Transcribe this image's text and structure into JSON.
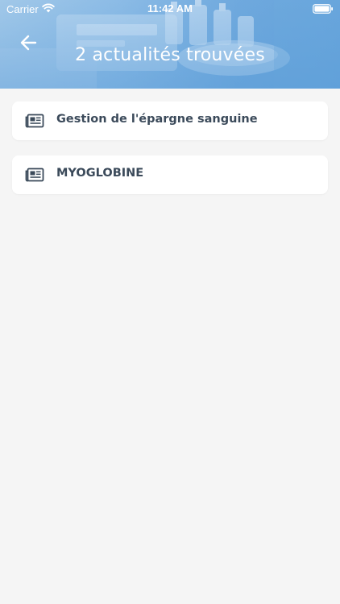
{
  "status_bar": {
    "carrier": "Carrier",
    "time": "11:42 AM",
    "wifi_icon": "wifi-icon",
    "battery_icon": "battery-icon"
  },
  "header": {
    "title": "2 actualités trouvées",
    "back_icon": "arrow-left-icon",
    "background": "laboratory-photo"
  },
  "news_items": [
    {
      "label": "Gestion de l'épargne sanguine",
      "icon": "newspaper-icon"
    },
    {
      "label": "MYOGLOBINE",
      "icon": "newspaper-icon"
    }
  ],
  "colors": {
    "header_start": "#a9cdea",
    "header_end": "#5f9fd9",
    "background": "#f5f5f5",
    "card": "#ffffff",
    "text": "#3b4a5a"
  }
}
